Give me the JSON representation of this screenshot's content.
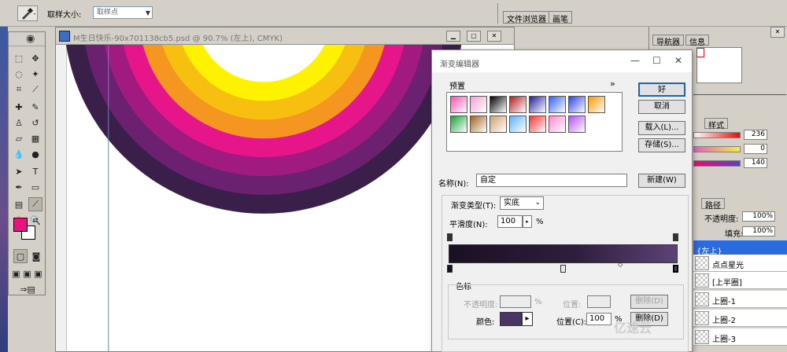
{
  "options_bar": {
    "sample_size_label": "取样大小:",
    "sample_size_value": "取样点",
    "file_browser_tab": "文件浏览器",
    "brush_tab": "画笔"
  },
  "toolbox": {
    "logo": "◉",
    "foreground_color": "#e8137f",
    "background_color": "#ffffff"
  },
  "document": {
    "title": "M生日快乐-90x701138cb5.psd @ 90.7% (左上), CMYK)",
    "arc_colors": [
      "#3a1f4a",
      "#6b2170",
      "#a01a80",
      "#e6158a",
      "#f59620",
      "#f7c010",
      "#fff200"
    ]
  },
  "right_panels": {
    "navigator_tab": "导航器",
    "info_tab": "信息",
    "style_tab": "样式",
    "color_values": [
      "236",
      "0",
      "140"
    ],
    "path_tab": "路径",
    "opacity_label": "不透明度:",
    "opacity_value": "100%",
    "fill_label": "填充:",
    "fill_value": "100%",
    "layers": [
      {
        "name": "{左上}",
        "selected": true
      },
      {
        "name": "点点星光"
      },
      {
        "name": "[上半圈]"
      },
      {
        "name": "上圈-1"
      },
      {
        "name": "上圈-2"
      },
      {
        "name": "上圈-3"
      }
    ]
  },
  "gradient_editor": {
    "title": "渐变编辑器",
    "presets_label": "预置",
    "presets_menu": "»",
    "ok_button": "好",
    "cancel_button": "取消",
    "load_button": "载入(L)...",
    "save_button": "存储(S)...",
    "name_label": "名称(N):",
    "name_value": "自定",
    "new_button": "新建(W)",
    "gradient_type_label": "渐变类型(T):",
    "gradient_type_value": "实底",
    "smoothness_label": "平滑度(N):",
    "smoothness_value": "100",
    "percent": "%",
    "stops_group_label": "色标",
    "opacity_label": "不透明度:",
    "position_label_disabled": "位置:",
    "delete_label_disabled": "删除(D)",
    "color_label": "颜色:",
    "position_label": "位置(C):",
    "position_value": "100",
    "delete_label": "删除(D)",
    "stop_color": "#4a3566",
    "presets": [
      [
        "#ff4fb0",
        "#f4a0d0",
        "#000000",
        "#b02020",
        "#2020a0",
        "#3060ff",
        "#2a3fff",
        "#ff9a00"
      ],
      [
        "#1aa03a",
        "#a06020",
        "#d0a070",
        "#60b0ff",
        "#ff3030",
        "#ff8ad0",
        "#b050ff"
      ]
    ]
  },
  "watermark": "亿速云"
}
